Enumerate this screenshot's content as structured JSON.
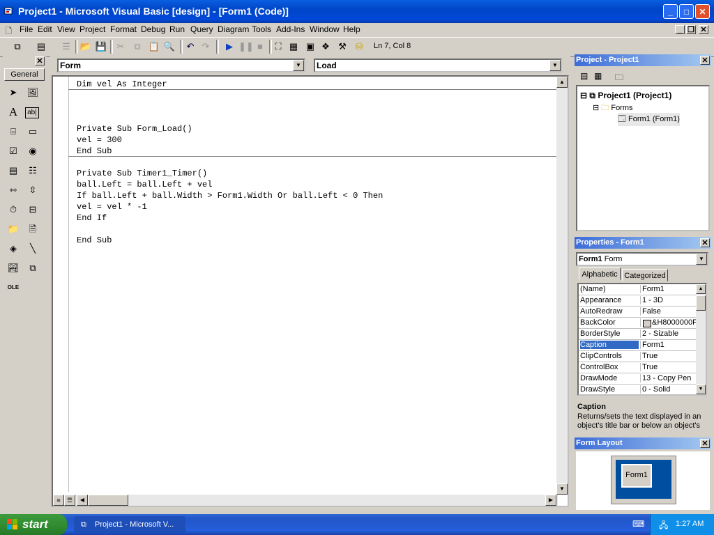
{
  "window": {
    "title": "Project1 - Microsoft Visual Basic [design] - [Form1 (Code)]"
  },
  "menubar": {
    "items": [
      "File",
      "Edit",
      "View",
      "Project",
      "Format",
      "Debug",
      "Run",
      "Query",
      "Diagram",
      "Tools",
      "Add-Ins",
      "Window",
      "Help"
    ]
  },
  "toolbar": {
    "position": "Ln 7, Col 8"
  },
  "toolbox": {
    "tab_label": "General"
  },
  "code": {
    "object_combo": "Form",
    "procedure_combo": "Load",
    "lines": [
      "Dim vel As Integer",
      "Private Sub Form_Load()",
      "vel = 300",
      "End Sub",
      "Private Sub Timer1_Timer()",
      "ball.Left = ball.Left + vel",
      "If ball.Left + ball.Width > Form1.Width Or ball.Left < 0 Then",
      "vel = vel * -1",
      "End If",
      "End Sub"
    ]
  },
  "project_panel": {
    "title": "Project - Project1",
    "root": "Project1 (Project1)",
    "folder": "Forms",
    "item": "Form1 (Form1)"
  },
  "properties_panel": {
    "title": "Properties - Form1",
    "object_name": "Form1",
    "object_type": "Form",
    "tabs": [
      "Alphabetic",
      "Categorized"
    ],
    "rows": [
      {
        "name": "(Name)",
        "value": "Form1"
      },
      {
        "name": "Appearance",
        "value": "1 - 3D"
      },
      {
        "name": "AutoRedraw",
        "value": "False"
      },
      {
        "name": "BackColor",
        "value": "&H8000000F"
      },
      {
        "name": "BorderStyle",
        "value": "2 - Sizable"
      },
      {
        "name": "Caption",
        "value": "Form1"
      },
      {
        "name": "ClipControls",
        "value": "True"
      },
      {
        "name": "ControlBox",
        "value": "True"
      },
      {
        "name": "DrawMode",
        "value": "13 - Copy Pen"
      },
      {
        "name": "DrawStyle",
        "value": "0 - Solid"
      }
    ],
    "selected": "Caption",
    "desc_title": "Caption",
    "desc_text": "Returns/sets the text displayed in an object's title bar or below an object's"
  },
  "layout_panel": {
    "title": "Form Layout",
    "form_label": "Form1"
  },
  "taskbar": {
    "start": "start",
    "task": "Project1 - Microsoft V...",
    "clock": "1:27 AM"
  },
  "colors": {
    "titlebar": "#0046c8",
    "selection": "#316ac5",
    "desktop": "#004ea0",
    "start": "#2f8b2f"
  }
}
